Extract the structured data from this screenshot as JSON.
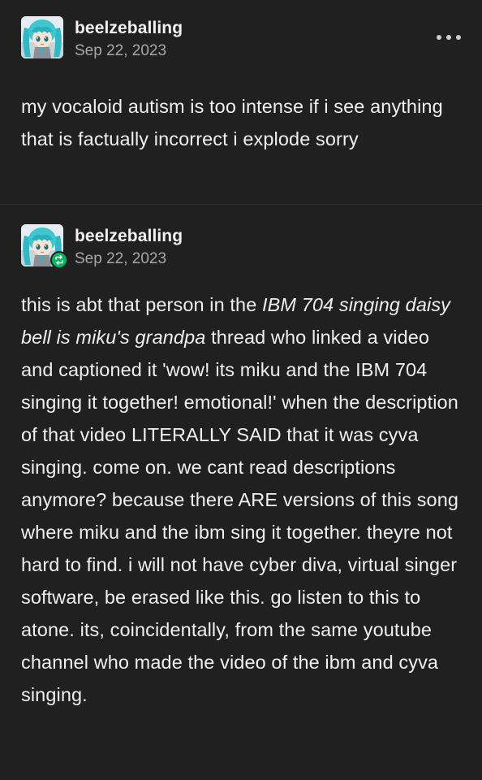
{
  "posts": [
    {
      "username": "beelzeballing",
      "date": "Sep 22, 2023",
      "body": "my vocaloid autism is too intense if i see anything that is factually incorrect i explode sorry",
      "menu_icon": "ellipsis-icon"
    },
    {
      "username": "beelzeballing",
      "date": "Sep 22, 2023",
      "reblog_icon": "reblog-icon",
      "body_prefix": "this is abt that person in the ",
      "body_italic": "IBM 704 singing daisy bell is miku's grandpa",
      "body_suffix": " thread who linked a video and captioned it 'wow! its miku and the IBM 704 singing it together! emotional!' when the description of that video LITERALLY SAID that it was cyva singing. come on. we cant read descriptions anymore? because there ARE versions of this song where miku and the ibm sing it together. theyre not hard to find. i will not have cyber diva, virtual singer software, be erased like this. go listen to this to atone. its, coincidentally, from the same youtube channel who made the video of the ibm and cyva singing."
    }
  ],
  "colors": {
    "background": "#202020",
    "text": "#efefef",
    "muted": "#a8a8a8",
    "reblog_green": "#00b85c"
  }
}
